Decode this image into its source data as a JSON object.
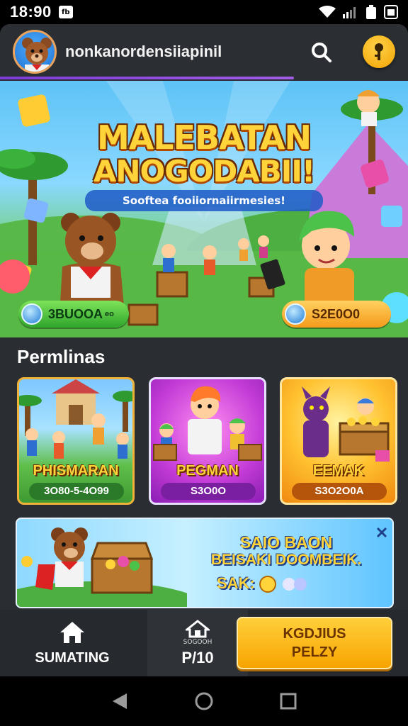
{
  "status_bar": {
    "time": "18:90",
    "notif_badge": "fb"
  },
  "header": {
    "app_title": "nonkanordensiiapinil"
  },
  "hero": {
    "title_line1": "MALEBATAN",
    "title_line2": "ANOGODABII!",
    "subtitle": "Sooftea fooiiornaiirmesies!",
    "left_pill": "3BUOOA",
    "left_pill_small": "eo",
    "right_pill": "S2E0O0"
  },
  "section": {
    "title": "Permlinas"
  },
  "cards": [
    {
      "title": "PHISMARAN",
      "price": "3O80-5-4O99"
    },
    {
      "title": "PEGMAN",
      "price": "S3O0O"
    },
    {
      "title": "EEMAK",
      "price": "S3O2O0A"
    }
  ],
  "promo": {
    "line1": "SAIO BAON",
    "line2": "BEISAKI DOOMBEIK.",
    "line3": "SAK:"
  },
  "bottom_nav": {
    "home_label": "SUMATING",
    "mid_small": "SOGOOH",
    "mid_label": "P/10",
    "cta_line1": "KGDJIUS",
    "cta_line2": "PELZY"
  },
  "colors": {
    "accent_purple": "#8e46dc",
    "gold": "#f7a400",
    "background": "#2a2e33"
  }
}
